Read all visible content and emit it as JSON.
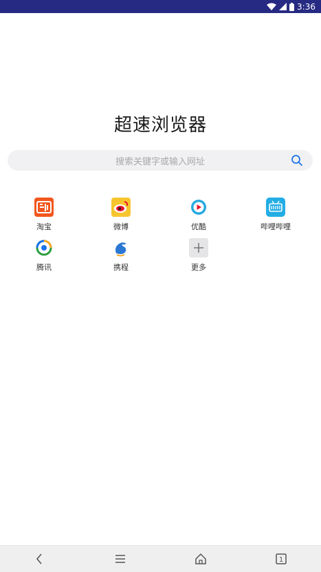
{
  "status_bar": {
    "time": "3:36"
  },
  "app": {
    "title": "超速浏览器"
  },
  "search": {
    "placeholder": "搜索关键字或输入网址"
  },
  "shortcuts": [
    {
      "label": "淘宝",
      "icon": "taobao-icon"
    },
    {
      "label": "微博",
      "icon": "weibo-icon"
    },
    {
      "label": "优酷",
      "icon": "youku-icon"
    },
    {
      "label": "哔哩哔哩",
      "icon": "bilibili-icon"
    },
    {
      "label": "腾讯",
      "icon": "tencent-icon"
    },
    {
      "label": "携程",
      "icon": "ctrip-icon"
    },
    {
      "label": "更多",
      "icon": "plus-icon"
    }
  ],
  "nav": {
    "tab_count": "1"
  },
  "colors": {
    "status_bar": "#262a82",
    "accent": "#1a73e8"
  }
}
